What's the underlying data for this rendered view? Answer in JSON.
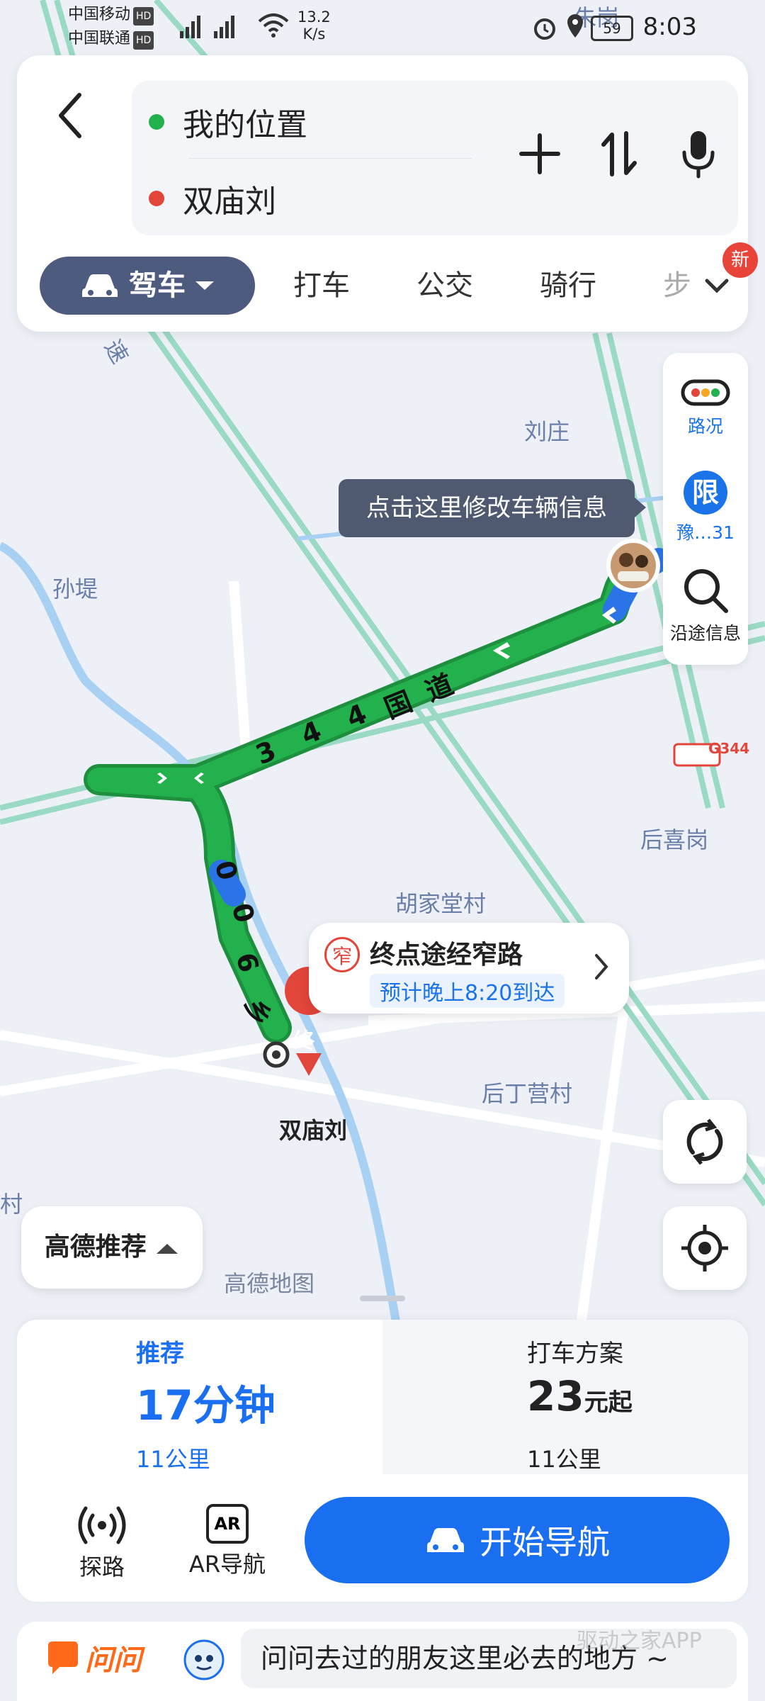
{
  "status_bar": {
    "carrier1": "中国移动",
    "carrier2": "中国联通",
    "hd": "HD",
    "net_speed_value": "13.2",
    "net_speed_unit": "K/s",
    "battery": "59",
    "time": "8:03"
  },
  "route": {
    "origin": "我的位置",
    "destination": "双庙刘"
  },
  "modes": {
    "active": "驾车",
    "items": [
      "打车",
      "公交",
      "骑行",
      "步"
    ],
    "new_badge": "新"
  },
  "tools": {
    "traffic_label": "路况",
    "restrict_badge": "限",
    "restrict_label": "豫…31",
    "along_label": "沿途信息"
  },
  "tooltip": "点击这里修改车辆信息",
  "map_labels": {
    "liuzhuang": "刘庄",
    "sundi": "孙堤",
    "houxigang": "后喜岗",
    "hujiatang": "胡家堂村",
    "houdingying": "后丁营村",
    "shuangmiaoliu": "双庙刘",
    "zhugang": "朱岗",
    "cun": "村",
    "su": "速",
    "g344": "G344",
    "watermark": "高德地图",
    "end_marker": "终"
  },
  "road_labels": {
    "national": [
      "3",
      "4",
      "4",
      "国",
      "道"
    ],
    "township": [
      "0",
      "0",
      "6",
      "乡"
    ]
  },
  "destination_card": {
    "badge": "窄",
    "title": "终点途经窄路",
    "eta": "预计晚上8:20到达"
  },
  "recommend_pill": "高德推荐",
  "options": {
    "recommended": {
      "label": "推荐",
      "time": "17分钟",
      "distance": "11公里"
    },
    "taxi": {
      "label": "打车方案",
      "price": "23",
      "price_suffix": "元起",
      "distance": "11公里"
    }
  },
  "bottom_tools": {
    "explore": "探路",
    "ar_nav": "AR导航",
    "ar_icon_text": "AR"
  },
  "nav_button": "开始导航",
  "ask": {
    "logo": "问问",
    "tip": "问问去过的朋友这里必去的地方 ~",
    "watermark": "驱动之家APP"
  },
  "colors": {
    "route_green": "#22b14c",
    "route_blue": "#2b74e8",
    "primary_blue": "#1a6ff0",
    "accent_red": "#e2453a"
  }
}
